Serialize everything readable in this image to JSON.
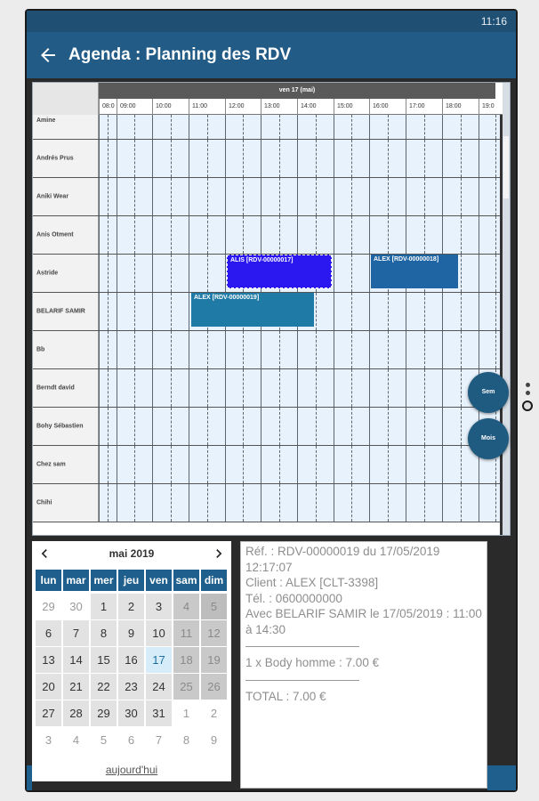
{
  "status": {
    "time": "11:16"
  },
  "appbar": {
    "title": "Agenda : Planning des RDV",
    "back_icon": "arrow-left-icon"
  },
  "scheduler": {
    "day_label": "ven 17 (mai)",
    "hours": [
      "08:0",
      "09:00",
      "10:00",
      "11:00",
      "12:00",
      "13:00",
      "14:00",
      "15:00",
      "16:00",
      "17:00",
      "18:00",
      "19:0"
    ],
    "rows": [
      "Amine",
      "Andrés Prus",
      "Aniki Wear",
      "Anis Otment",
      "Astride",
      "BELARIF SAMIR",
      "Bb",
      "Berndt david",
      "Bohy Sébastien",
      "Chez sam",
      "Chihi"
    ],
    "events": [
      {
        "label": "ALIS [RDV-00000017]",
        "color": "#2b17f0"
      },
      {
        "label": "ALEX [RDV-00000018]",
        "color": "#1f64a3"
      },
      {
        "label": "ALEX [RDV-00000019]",
        "color": "#1f7aa6"
      }
    ],
    "fab_week": "Sem",
    "fab_month": "Mois"
  },
  "calendar": {
    "month_label": "mai 2019",
    "weekdays": [
      "lun",
      "mar",
      "mer",
      "jeu",
      "ven",
      "sam",
      "dim"
    ],
    "weeks": [
      [
        "29",
        "30",
        "1",
        "2",
        "3",
        "4",
        "5"
      ],
      [
        "6",
        "7",
        "8",
        "9",
        "10",
        "11",
        "12"
      ],
      [
        "13",
        "14",
        "15",
        "16",
        "17",
        "18",
        "19"
      ],
      [
        "20",
        "21",
        "22",
        "23",
        "24",
        "25",
        "26"
      ],
      [
        "27",
        "28",
        "29",
        "30",
        "31",
        "1",
        "2"
      ],
      [
        "3",
        "4",
        "5",
        "6",
        "7",
        "8",
        "9"
      ]
    ],
    "today_link": "aujourd'hui",
    "selected_day": "17"
  },
  "detail": {
    "ref": "Réf. : RDV-00000019 du 17/05/2019 12:17:07",
    "client": "Client : ALEX [CLT-3398]",
    "tel": "Tél. : 0600000000",
    "avec": "Avec BELARIF SAMIR le 17/05/2019 : 11:00 à 14:30",
    "item": "1 x Body homme  :   7.00 €",
    "total": "TOTAL :   7.00 €"
  }
}
